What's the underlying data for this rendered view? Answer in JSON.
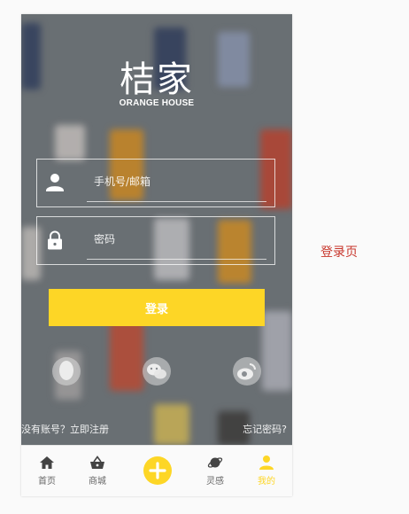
{
  "brand": {
    "title": "桔家",
    "subtitle": "ORANGE HOUSE"
  },
  "form": {
    "account_placeholder": "手机号/邮箱",
    "password_placeholder": "密码",
    "login_label": "登录"
  },
  "social": [
    "qq-icon",
    "wechat-icon",
    "weibo-icon"
  ],
  "links": {
    "register": "没有账号？立即注册",
    "forgot": "忘记密码?"
  },
  "tabbar": {
    "items": [
      {
        "label": "首页",
        "icon": "home-icon"
      },
      {
        "label": "商城",
        "icon": "shopping-basket-icon"
      },
      {
        "label": "",
        "icon": "plus-icon"
      },
      {
        "label": "灵感",
        "icon": "planet-icon"
      },
      {
        "label": "我的",
        "icon": "person-icon",
        "active": true
      }
    ]
  },
  "page_caption": "登录页",
  "colors": {
    "accent": "#fdd626",
    "caption": "#c8362c"
  }
}
